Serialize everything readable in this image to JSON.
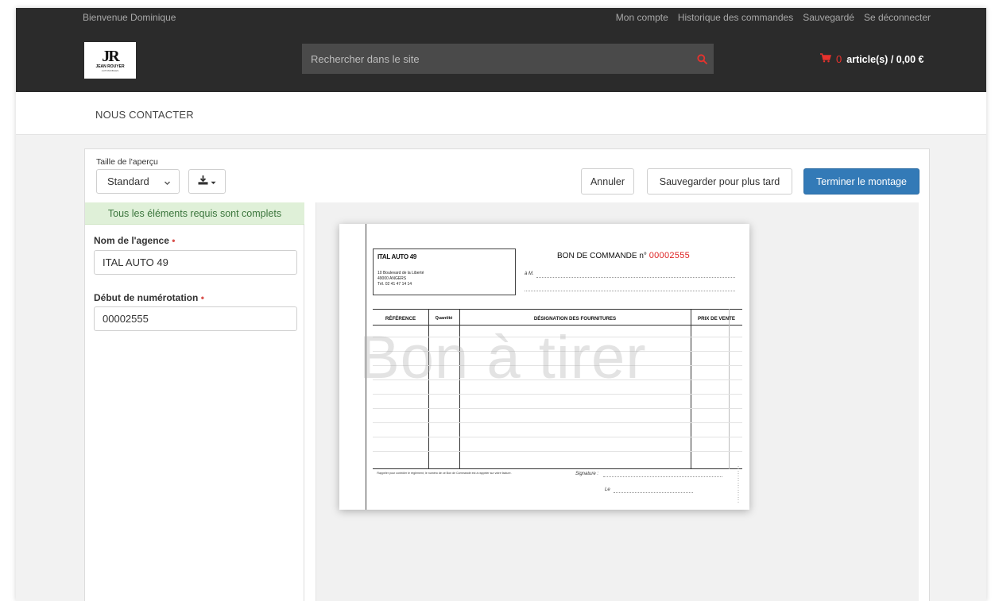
{
  "header": {
    "welcome": "Bienvenue Dominique",
    "links": [
      "Mon compte",
      "Historique des commandes",
      "Sauvegardé",
      "Se déconnecter"
    ],
    "search_placeholder": "Rechercher dans le site",
    "cart": {
      "count": "0",
      "text": "article(s) / 0,00 €"
    },
    "logo": {
      "monogram": "JR",
      "brand": "JEAN ROUYER",
      "sub": "AUTOMOBILES"
    }
  },
  "nav": {
    "contact": "NOUS CONTACTER"
  },
  "toolbar": {
    "preview_size_label": "Taille de l'aperçu",
    "preview_size_value": "Standard",
    "cancel": "Annuler",
    "save_later": "Sauvegarder pour plus tard",
    "finish": "Terminer le montage"
  },
  "form": {
    "status": "Tous les éléments requis sont complets",
    "agency_label": "Nom de l'agence",
    "agency_value": "ITAL AUTO 49",
    "numbering_label": "Début de numérotation",
    "numbering_value": "00002555",
    "required_marker": "•"
  },
  "document": {
    "issuer_name": "ITAL AUTO 49",
    "issuer_address": "10 Boulevard de la Liberté",
    "issuer_city": "49000 ANGERS",
    "issuer_phone": "Tél. 02 41 47 14 14",
    "title": "BON DE COMMANDE n°",
    "number": "00002555",
    "recipient": "à M.",
    "columns": [
      "RÉFÉRENCE",
      "Quantité",
      "DÉSIGNATION DES FOURNITURES",
      "PRIX DE VENTE"
    ],
    "watermark": "Bon à tirer",
    "footer_note": "Rappeler pour contrôler le règlement, le numéro de ce Bon de Commande est à rappeler sur votre facture.",
    "signature": "Signature :",
    "date": "Le"
  },
  "colors": {
    "topbar": "#2b2b2b",
    "accent_red": "#e8322d",
    "primary_button": "#337ab7",
    "success_bg": "#dff0d8",
    "success_text": "#3c763d"
  },
  "icons": {
    "search": "search-icon",
    "cart": "cart-icon",
    "download": "download-icon",
    "dropdown": "chevron-down-icon"
  }
}
